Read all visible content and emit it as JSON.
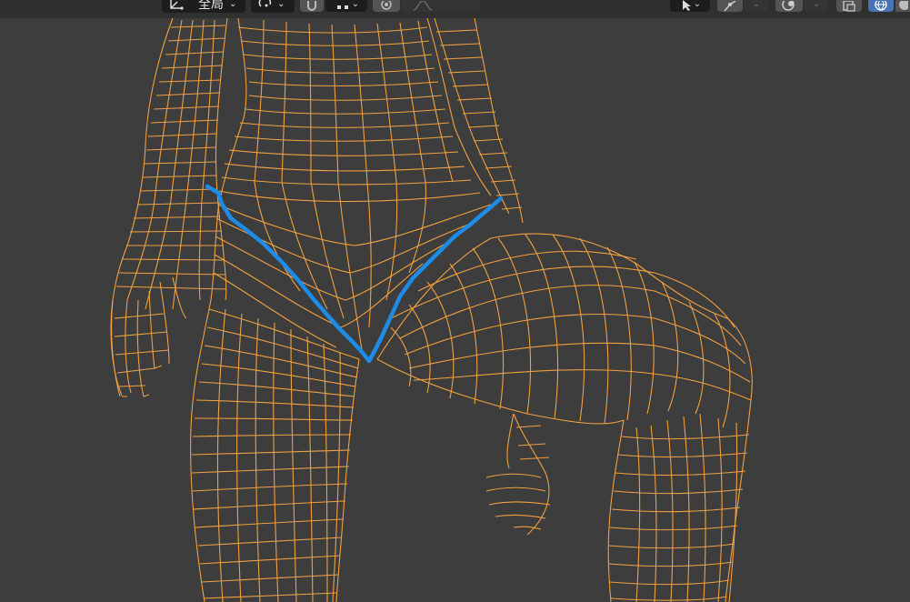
{
  "header": {
    "transform_orientation_label": "全局",
    "icons": {
      "orientation": "orientation-axes-icon",
      "pivot": "pivot-point-icon",
      "snap": "snap-magnet-icon",
      "snap_target": "snap-increment-icon",
      "proportional": "proportional-editing-icon",
      "falloff": "falloff-curve-icon",
      "select_tool": "select-cursor-icon",
      "gizmo": "gizmo-icon",
      "overlay": "overlay-icon",
      "xray": "xray-toggle-icon",
      "shading_wire": "wireframe-shading-icon",
      "shading_solid": "solid-shading-icon"
    }
  },
  "viewport": {
    "wire_color": "#f0a040",
    "background_color": "#3d3d3d",
    "stroke_color": "#1e8ce6"
  }
}
